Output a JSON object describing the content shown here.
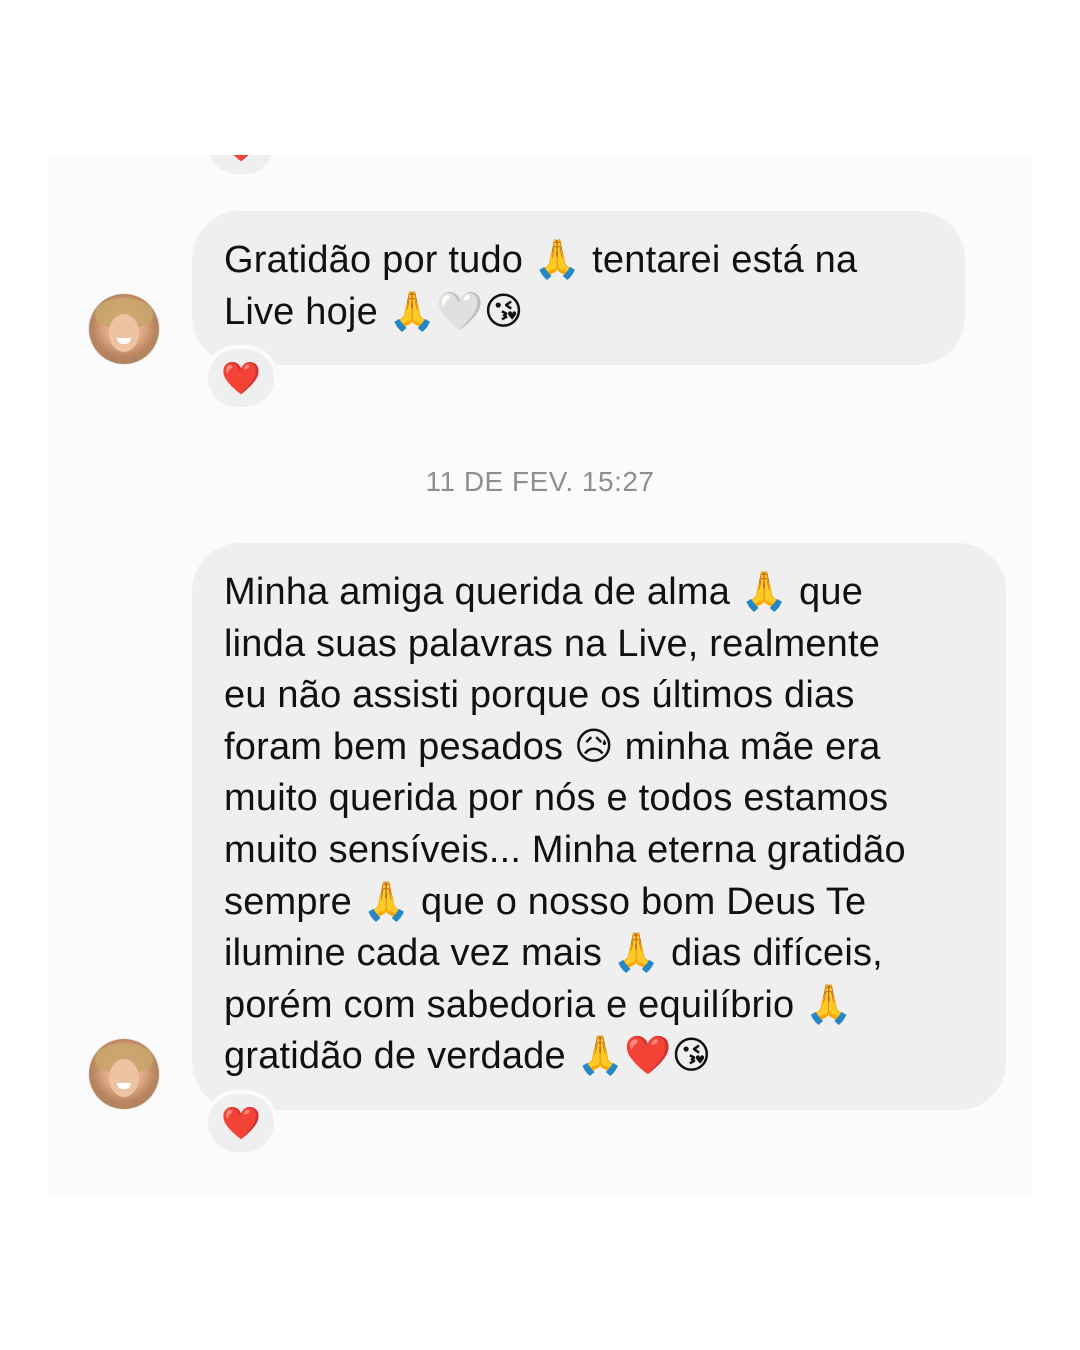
{
  "thread": {
    "timestamp": "11 DE FEV. 15:27",
    "reaction_symbol": "❤️",
    "messages": [
      {
        "text": "Gratidão por tudo 🙏 tentarei está na\nLive hoje 🙏🤍😘",
        "reaction": "❤️"
      },
      {
        "text": "Minha amiga querida de alma 🙏 que\nlinda suas palavras na Live, realmente\neu não assisti porque os últimos dias\nforam bem pesados 😥 minha mãe era\nmuito querida por nós e todos estamos\nmuito sensíveis... Minha eterna gratidão\nsempre 🙏 que o nosso bom Deus Te\nilumine cada vez mais 🙏 dias difíceis,\nporém com sabedoria e equilíbrio 🙏\ngratidão de verdade 🙏❤️😘",
        "reaction": "❤️"
      }
    ]
  },
  "colors": {
    "bubble": "#efefef",
    "panel": "#fbfbfb",
    "text": "#111111",
    "timestamp": "#8e8e8e",
    "heart": "#e8202a"
  }
}
